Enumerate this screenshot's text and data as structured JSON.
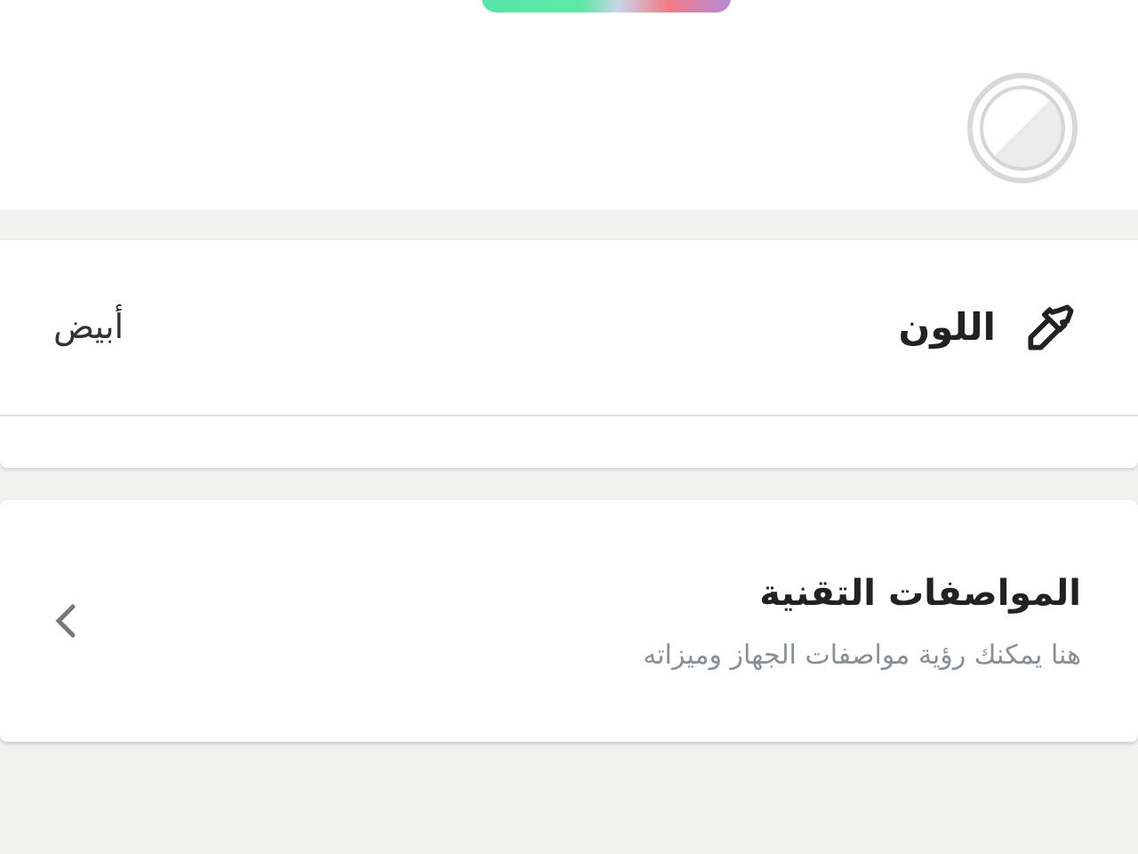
{
  "color_option": {
    "selected": true
  },
  "color_row": {
    "label": "اللون",
    "value": "أبيض"
  },
  "specs_card": {
    "title": "المواصفات التقنية",
    "subtitle": "هنا يمكنك رؤية مواصفات الجهاز وميزاته"
  }
}
